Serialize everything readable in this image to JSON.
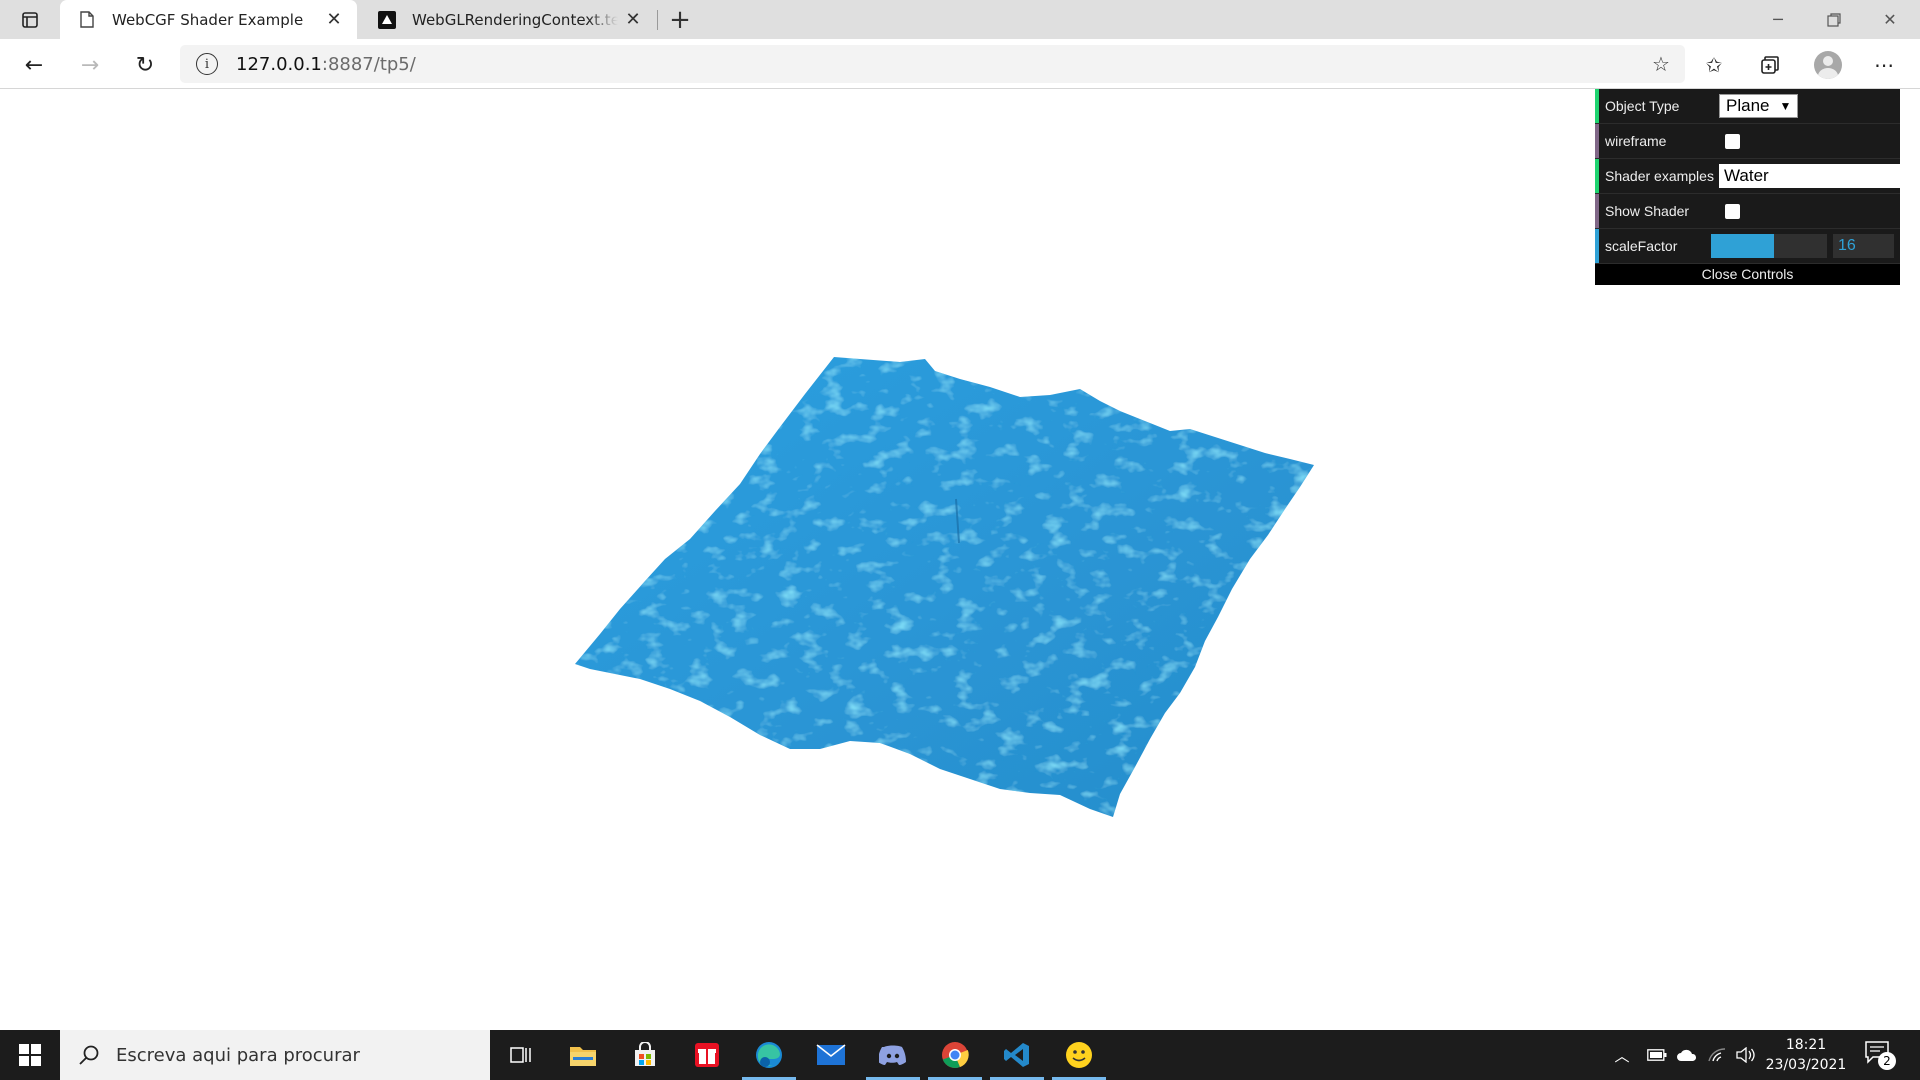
{
  "browser": {
    "tabs": [
      {
        "title": "WebCGF Shader Example",
        "active": true
      },
      {
        "title": "WebGLRenderingContext.texParameter()",
        "active": false
      }
    ],
    "url_host": "127.0.0.1",
    "url_rest": ":8887/tp5/"
  },
  "gui": {
    "object_type_label": "Object Type",
    "object_type_value": "Plane",
    "wireframe_label": "wireframe",
    "wireframe_checked": false,
    "shader_label": "Shader examples",
    "shader_value": "Water",
    "show_shader_label": "Show Shader",
    "show_shader_checked": false,
    "scale_label": "scaleFactor",
    "scale_value": "16",
    "scale_fraction": 0.54,
    "close_label": "Close Controls"
  },
  "taskbar": {
    "search_placeholder": "Escreva aqui para procurar",
    "time": "18:21",
    "date": "23/03/2021",
    "notification_count": "2"
  },
  "colors": {
    "water": "#2b9ad8",
    "gui_bg": "#1a1a1a",
    "slider": "#2fa1d6"
  }
}
